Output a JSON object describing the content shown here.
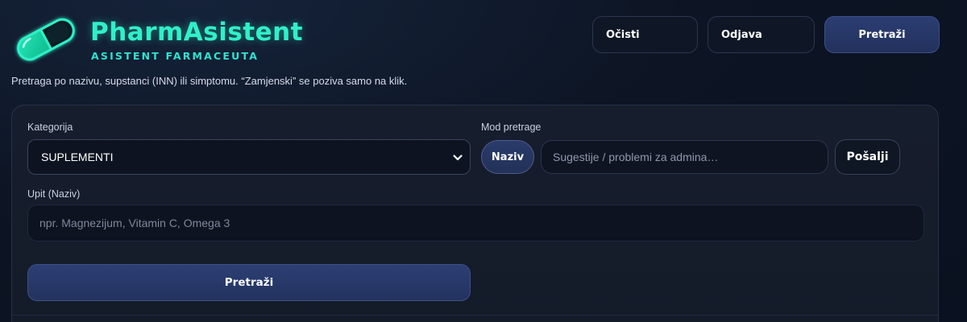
{
  "header": {
    "app_title": "PharmAsistent",
    "app_subtitle": "ASISTENT FARMACEUTA",
    "tagline": "Pretraga po nazivu, supstanci (INN) ili simptomu. “Zamjenski” se poziva samo na klik.",
    "logo_icon": "pill-capsule-icon",
    "accent_color": "#2ff0c8"
  },
  "top_actions": {
    "clear_label": "Očisti",
    "logout_label": "Odjava",
    "search_label": "Pretraži"
  },
  "form": {
    "category_label": "Kategorija",
    "category_value": "SUPLEMENTI",
    "mode_label": "Mod pretrage",
    "mode_value": "Naziv",
    "suggestion_placeholder": "Sugestije / problemi za admina…",
    "send_label": "Pošalji",
    "query_label": "Upit (Naziv)",
    "query_placeholder": "npr. Magnezijum, Vitamin C, Omega 3",
    "search_label": "Pretraži"
  }
}
